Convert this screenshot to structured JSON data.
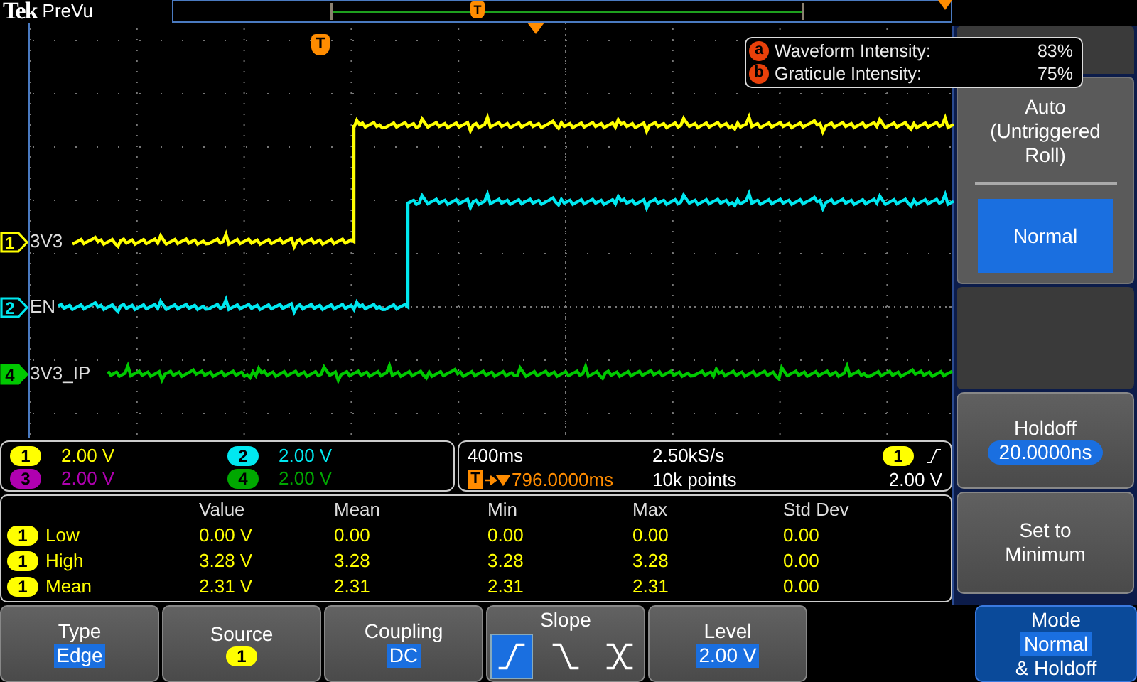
{
  "header": {
    "brand": "Tek",
    "product": "PreVu",
    "record_marker": "T"
  },
  "screen": {
    "trigger_marker": "T",
    "traces": [
      {
        "channel": "1",
        "label": "3V3",
        "color": "#ffff00",
        "selected": false
      },
      {
        "channel": "2",
        "label": "EN",
        "color": "#00e8f0",
        "selected": false
      },
      {
        "channel": "4",
        "label": "3V3_IP",
        "color": "#00c800",
        "selected": true
      }
    ],
    "intensity_popup": [
      {
        "key": "a",
        "label": "Waveform Intensity:",
        "value": "83%"
      },
      {
        "key": "b",
        "label": "Graticule Intensity:",
        "value": "75%"
      }
    ]
  },
  "channel_readouts": [
    {
      "channel": "1",
      "scale": "2.00 V",
      "color": "#ffff00"
    },
    {
      "channel": "2",
      "scale": "2.00 V",
      "color": "#00e8f0"
    },
    {
      "channel": "3",
      "scale": "2.00 V",
      "color": "#b000b0"
    },
    {
      "channel": "4",
      "scale": "2.00 V",
      "color": "#00a800"
    }
  ],
  "timebase": {
    "scale": "400ms",
    "sample_rate": "2.50kS/s",
    "trigger_source": "1",
    "position_marker": "T",
    "position": "796.0000ms",
    "record_length": "10k points",
    "trigger_level": "2.00 V"
  },
  "measurements": {
    "columns": [
      "Value",
      "Mean",
      "Min",
      "Max",
      "Std Dev"
    ],
    "rows": [
      {
        "source": "1",
        "name": "Low",
        "cells": [
          "0.00 V",
          "0.00",
          "0.00",
          "0.00",
          "0.00"
        ]
      },
      {
        "source": "1",
        "name": "High",
        "cells": [
          "3.28 V",
          "3.28",
          "3.28",
          "3.28",
          "0.00"
        ]
      },
      {
        "source": "1",
        "name": "Mean",
        "cells": [
          "2.31 V",
          "2.31",
          "2.31",
          "2.31",
          "0.00"
        ]
      }
    ]
  },
  "side_menu": {
    "options": [
      {
        "label": "Auto (Untriggered Roll)",
        "selected": false
      },
      {
        "label": "Normal",
        "selected": true
      }
    ],
    "holdoff": {
      "label": "Holdoff",
      "value": "20.0000ns"
    },
    "set_minimum": "Set to Minimum"
  },
  "bottom_menu": [
    {
      "kind": "value",
      "label": "Type",
      "value": "Edge",
      "active": false
    },
    {
      "kind": "source",
      "label": "Source",
      "value": "1",
      "active": false
    },
    {
      "kind": "value",
      "label": "Coupling",
      "value": "DC",
      "active": false
    },
    {
      "kind": "slope",
      "label": "Slope",
      "active": false,
      "slopes": [
        {
          "kind": "rising",
          "selected": true
        },
        {
          "kind": "falling",
          "selected": false
        },
        {
          "kind": "either",
          "selected": false
        }
      ]
    },
    {
      "kind": "value",
      "label": "Level",
      "value": "2.00 V",
      "active": false
    },
    {
      "kind": "mode",
      "label": "Mode",
      "value": "Normal",
      "suffix": "& Holdoff",
      "active": true
    }
  ]
}
